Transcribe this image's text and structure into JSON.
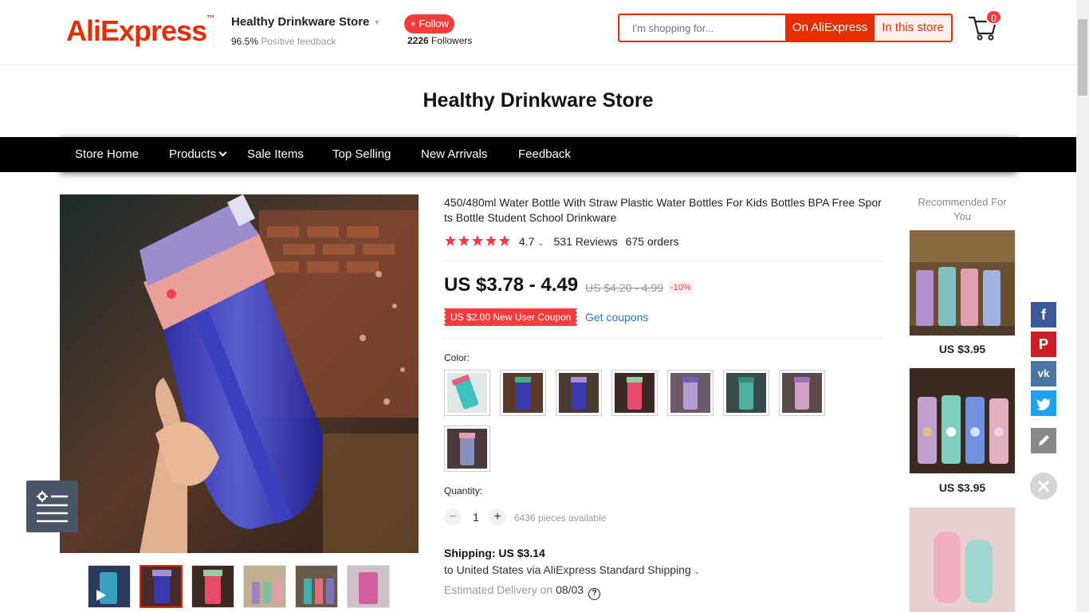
{
  "header": {
    "logo_text": "AliExpress",
    "logo_tm": "™",
    "store_name": "Healthy Drinkware Store",
    "feedback_pct": "96.5%",
    "feedback_label": "Positive feedback",
    "follow_label": "+ Follow",
    "followers_count": "2226",
    "followers_label": "Followers",
    "search_placeholder": "I'm shopping for...",
    "search_btn_all": "On AliExpress",
    "search_btn_store": "In this store",
    "cart_count": "0",
    "accent_color": "#e62e04"
  },
  "store_banner": {
    "title": "Healthy Drinkware Store"
  },
  "nav": {
    "items": [
      "Store Home",
      "Products",
      "Sale Items",
      "Top Selling",
      "New Arrivals",
      "Feedback"
    ]
  },
  "product": {
    "title": "450/480ml Water Bottle With Straw Plastic Water Bottles For Kids Bottles BPA Free Sports Bottle Student School Drinkware",
    "rating": "4.7",
    "reviews": "531 Reviews",
    "orders": "675 orders",
    "price": "US $3.78 - 4.49",
    "old_price": "US $4.20 - 4.99",
    "discount": "-10%",
    "coupon": "US $2.00 New User Coupon",
    "get_coupons": "Get coupons",
    "color_label": "Color:",
    "quantity_label": "Quantity:",
    "quantity": "1",
    "available": "6436 pieces available",
    "shipping_title": "Shipping: US $3.14",
    "shipping_to": "to United States via AliExpress Standard Shipping",
    "est_label": "Estimated Delivery on",
    "est_date": "08/03"
  },
  "recommended": {
    "title": "Recommended For You",
    "items": [
      {
        "price": "US $3.95"
      },
      {
        "price": "US $3.95"
      }
    ]
  },
  "social": [
    "facebook-icon",
    "pinterest-icon",
    "vk-icon",
    "twitter-icon",
    "edit-icon"
  ]
}
